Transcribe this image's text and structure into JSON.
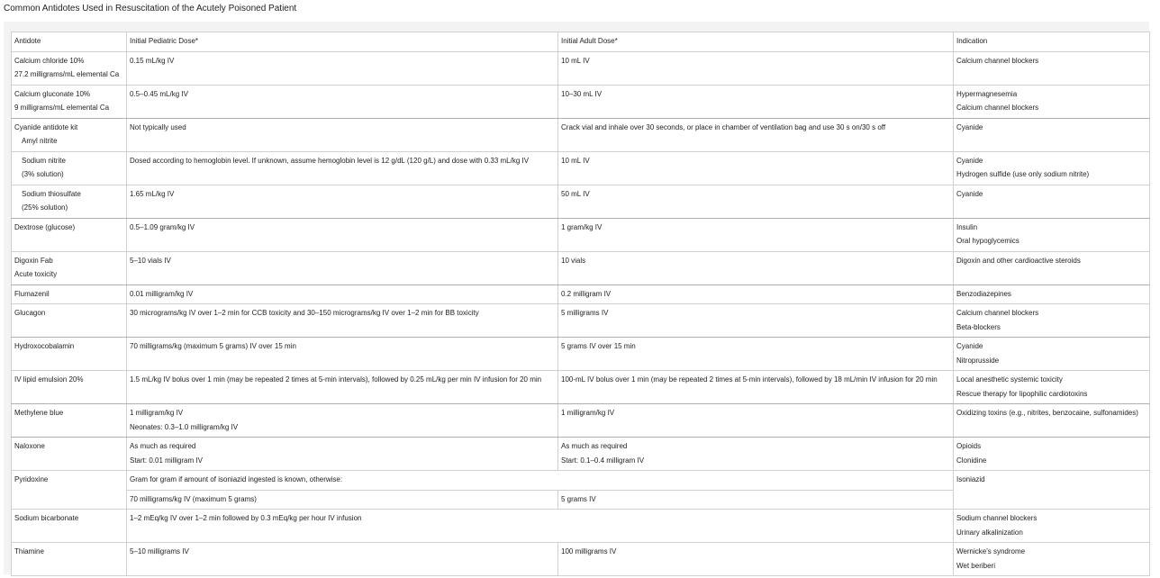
{
  "caption": "Common Antidotes Used in Resuscitation of the Acutely Poisoned Patient",
  "headers": [
    "Antidote",
    "Initial Pediatric Dose*",
    "Initial Adult Dose*",
    "Indication"
  ],
  "rows": [
    {
      "antidote": [
        "Calcium chloride 10%",
        "27.2 milligrams/mL elemental Ca"
      ],
      "ped": [
        "0.15 mL/kg IV"
      ],
      "adult": [
        "10 mL IV"
      ],
      "ind": [
        "Calcium channel blockers"
      ]
    },
    {
      "antidote": [
        "Calcium gluconate 10%",
        "9 milligrams/mL elemental Ca"
      ],
      "ped": [
        "0.5–0.45 mL/kg IV"
      ],
      "adult": [
        "10–30 mL IV"
      ],
      "ind": [
        "Hypermagnesemia",
        "Calcium channel blockers"
      ]
    },
    {
      "antidote": [
        "Cyanide antidote kit",
        "Amyl nitrite"
      ],
      "ped": [
        "Not typically used"
      ],
      "adult": [
        "Crack vial and inhale over 30 seconds, or place in chamber of ventilation bag and use 30 s on/30 s off"
      ],
      "ind": [
        "Cyanide"
      ]
    },
    {
      "antidote": [
        "Sodium nitrite",
        "(3% solution)"
      ],
      "ped": [
        "Dosed according to hemoglobin level. If unknown, assume hemoglobin level is 12 g/dL (120 g/L) and dose with 0.33 mL/kg IV"
      ],
      "adult": [
        "10 mL IV"
      ],
      "ind": [
        "Cyanide",
        "Hydrogen sulfide (use only sodium nitrite)"
      ]
    },
    {
      "antidote": [
        "Sodium thiosulfate",
        "(25% solution)"
      ],
      "ped": [
        "1.65 mL/kg IV"
      ],
      "adult": [
        "50 mL IV"
      ],
      "ind": [
        "Cyanide"
      ]
    },
    {
      "antidote": [
        "Dextrose (glucose)"
      ],
      "ped": [
        "0.5–1.09 gram/kg IV"
      ],
      "adult": [
        "1 gram/kg IV"
      ],
      "ind": [
        "Insulin",
        "Oral hypoglycemics"
      ]
    },
    {
      "antidote": [
        "Digoxin Fab",
        "Acute toxicity"
      ],
      "ped": [
        "5–10 vials IV"
      ],
      "adult": [
        "10 vials"
      ],
      "ind": [
        "Digoxin and other cardioactive steroids"
      ]
    },
    {
      "antidote": [
        "Flumazenil"
      ],
      "ped": [
        "0.01 milligram/kg IV"
      ],
      "adult": [
        "0.2 milligram IV"
      ],
      "ind": [
        "Benzodiazepines"
      ]
    },
    {
      "antidote": [
        "Glucagon"
      ],
      "ped": [
        "30 micrograms/kg IV over 1–2 min for CCB toxicity and 30–150 micrograms/kg IV over 1–2 min for BB toxicity"
      ],
      "adult": [
        "5 milligrams IV"
      ],
      "ind": [
        "Calcium channel blockers",
        "Beta-blockers"
      ]
    },
    {
      "antidote": [
        "Hydroxocobalamin"
      ],
      "ped": [
        "70 milligrams/kg (maximum 5 grams) IV over 15 min"
      ],
      "adult": [
        "5 grams IV over 15 min"
      ],
      "ind": [
        "Cyanide",
        "Nitroprusside"
      ]
    },
    {
      "antidote": [
        "IV lipid emulsion 20%"
      ],
      "ped": [
        "1.5 mL/kg IV bolus over 1 min (may be repeated 2 times at 5-min intervals), followed by 0.25 mL/kg per min IV infusion for 20 min"
      ],
      "adult": [
        "100-mL IV bolus over 1 min (may be repeated 2 times at 5-min intervals), followed by 18 mL/min IV infusion for 20 min"
      ],
      "ind": [
        "Local anesthetic systemic toxicity",
        "Rescue therapy for lipophilic cardiotoxins"
      ]
    },
    {
      "antidote": [
        "Methylene blue"
      ],
      "ped": [
        "1 milligram/kg IV",
        "Neonates: 0.3–1.0 milligram/kg IV"
      ],
      "adult": [
        "1 milligram/kg IV"
      ],
      "ind": [
        "Oxidizing toxins (e.g., nitrites, benzocaine, sulfonamides)"
      ]
    },
    {
      "antidote": [
        "Naloxone"
      ],
      "ped": [
        "As much as required",
        "Start: 0.01 milligram IV"
      ],
      "adult": [
        "As much as required",
        "Start: 0.1–0.4 milligram IV"
      ],
      "ind": [
        "Opioids",
        "Clonidine"
      ]
    }
  ],
  "pyridoxine": {
    "antidote": "Pyridoxine",
    "note": "Gram for gram if amount of isoniazid ingested is known, otherwise:",
    "ped": "70 milligrams/kg IV (maximum 5 grams)",
    "adult": "5 grams IV",
    "ind": "Isoniazid"
  },
  "bicarb": {
    "antidote": "Sodium bicarbonate",
    "dose": "1–2 mEq/kg IV over 1–2 min followed by 0.3 mEq/kg per hour IV infusion",
    "ind": [
      "Sodium channel blockers",
      "Urinary alkalinization"
    ]
  },
  "thiamine": {
    "antidote": "Thiamine",
    "ped": "5–10 milligrams IV",
    "adult": "100 milligrams IV",
    "ind": [
      "Wernicke's syndrome",
      "Wet beriberi"
    ]
  }
}
